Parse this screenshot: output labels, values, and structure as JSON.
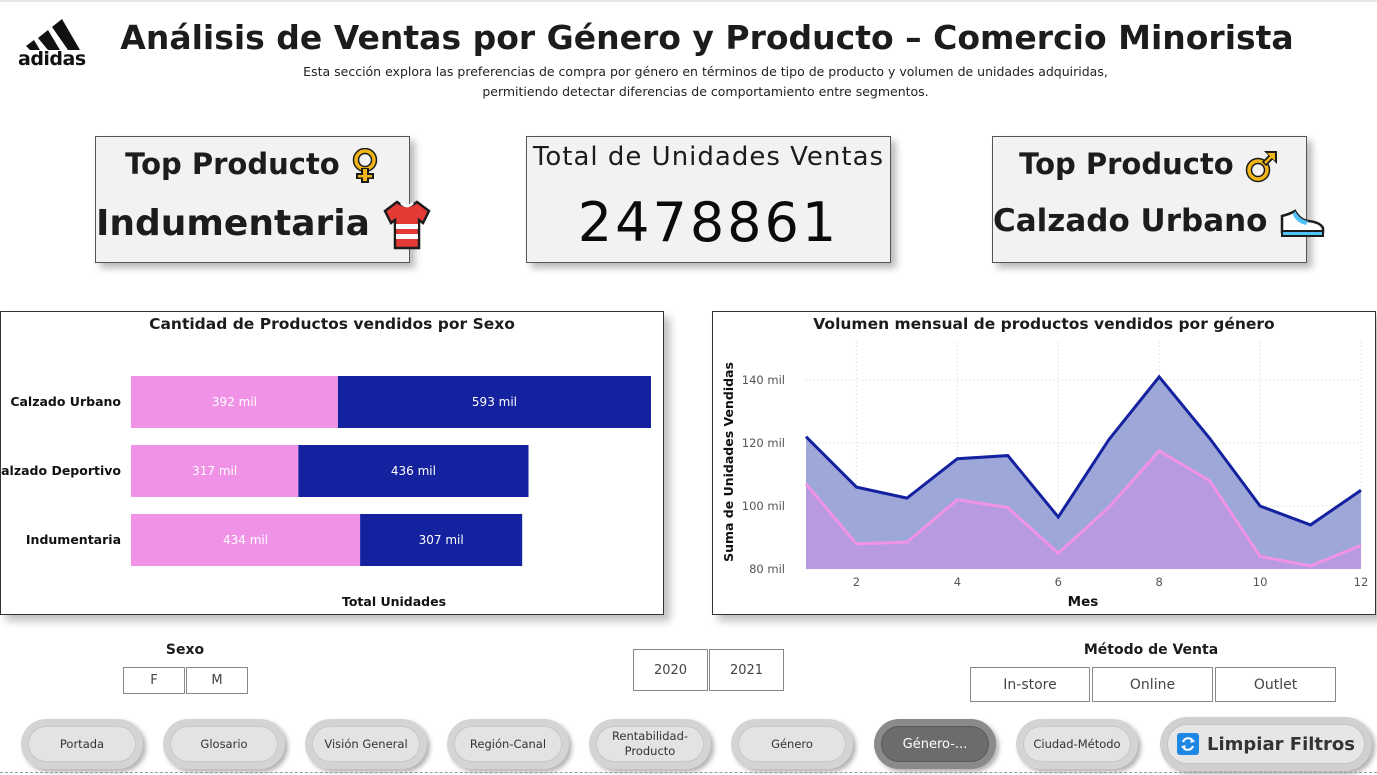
{
  "header": {
    "brand": "adidas",
    "title": "Análisis de Ventas por Género y Producto – Comercio Minorista",
    "subtitle_line1": "Esta sección explora las preferencias de compra por género en términos de tipo de producto y volumen de unidades adquiridas,",
    "subtitle_line2": "permitiendo detectar diferencias de comportamiento entre segmentos."
  },
  "kpis": {
    "female_top": {
      "label": "Top Producto",
      "value": "Indumentaria",
      "icon": "female-symbol-icon",
      "value_icon": "shirt-icon"
    },
    "total": {
      "label": "Total de Unidades Ventas",
      "value": "2478861"
    },
    "male_top": {
      "label": "Top Producto",
      "value": "Calzado Urbano",
      "icon": "male-symbol-icon",
      "value_icon": "sneaker-icon"
    }
  },
  "colors": {
    "female": "#f093e6",
    "male": "#1422a0",
    "female_area": "#b89ae0",
    "male_area": "#9ea8d8",
    "accent_gold": "#f2b61a"
  },
  "chart_data": [
    {
      "type": "bar",
      "orientation": "horizontal-stacked",
      "title": "Cantidad de Productos vendidos por Sexo",
      "xlabel": "Total Unidades",
      "ylabel": "",
      "categories": [
        "Calzado Urbano",
        "Calzado Deportivo",
        "Indumentaria"
      ],
      "series": [
        {
          "values": [
            392000,
            317000,
            434000
          ],
          "labels": [
            "392 mil",
            "317 mil",
            "434 mil"
          ]
        },
        {
          "values": [
            593000,
            436000,
            307000
          ],
          "labels": [
            "593 mil",
            "436 mil",
            "307 mil"
          ]
        }
      ]
    },
    {
      "type": "area",
      "title": "Volumen mensual de productos vendidos por género",
      "xlabel": "Mes",
      "ylabel": "Suma de Unidades Vendidas",
      "x": [
        1,
        2,
        3,
        4,
        5,
        6,
        7,
        8,
        9,
        10,
        11,
        12
      ],
      "xticks": [
        "2",
        "4",
        "6",
        "8",
        "10",
        "12"
      ],
      "ylim": [
        80000,
        150000
      ],
      "yticks": [
        "80 mil",
        "100 mil",
        "120 mil",
        "140 mil"
      ],
      "grid": true,
      "series": [
        {
          "values": [
            122000,
            106000,
            102500,
            115000,
            116000,
            96500,
            121000,
            141000,
            121500,
            100000,
            94000,
            105000
          ]
        },
        {
          "values": [
            107000,
            88000,
            88500,
            102000,
            99500,
            85000,
            99500,
            117500,
            108000,
            84000,
            81000,
            87500
          ]
        }
      ]
    }
  ],
  "slicers": {
    "sexo": {
      "title": "Sexo",
      "options": [
        "F",
        "M"
      ]
    },
    "year": {
      "options": [
        "2020",
        "2021"
      ]
    },
    "metodo": {
      "title": "Método de Venta",
      "options": [
        "In-store",
        "Online",
        "Outlet"
      ]
    }
  },
  "nav": {
    "buttons": [
      "Portada",
      "Glosario",
      "Visión General",
      "Región-Canal",
      "Rentabilidad-Producto",
      "Género",
      "Género-...",
      "Ciudad-Método"
    ],
    "active": "Género-...",
    "clear_label": "Limpiar Filtros",
    "clear_icon": "refresh-icon"
  }
}
